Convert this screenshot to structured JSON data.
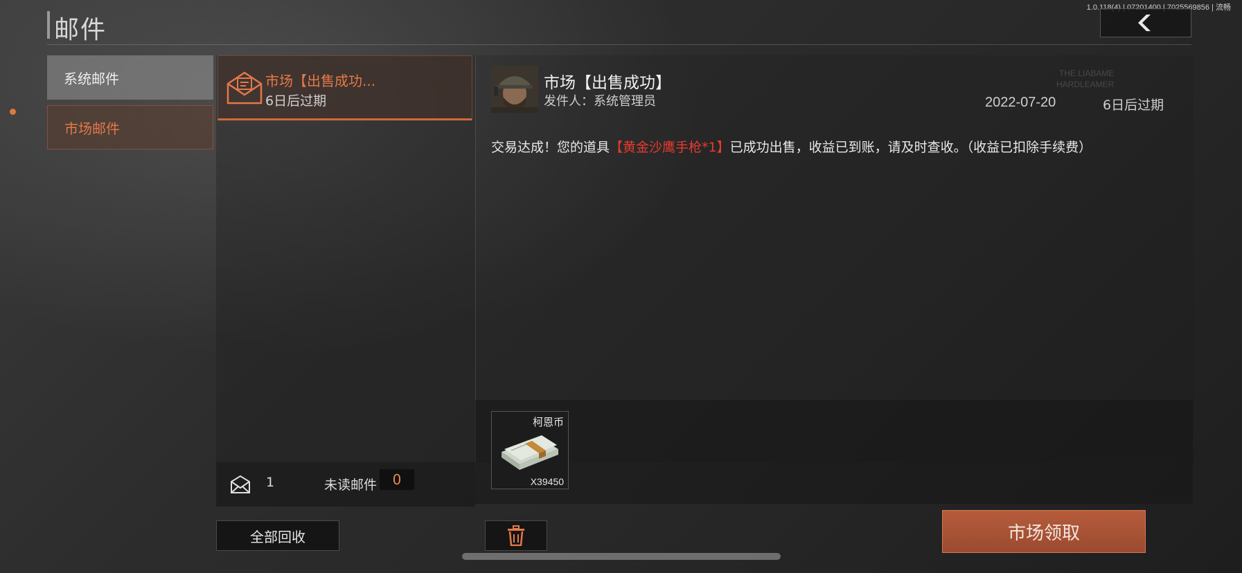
{
  "header": {
    "title": "邮件",
    "version": "1.0.118(4) | 07201400 | 7025569856 | 流畅"
  },
  "categories": [
    {
      "label": "系统邮件",
      "selected": false
    },
    {
      "label": "市场邮件",
      "selected": true
    }
  ],
  "mail_list": [
    {
      "title": "市场【出售成功...",
      "expiry": "6日后过期",
      "icon": "envelope-icon"
    }
  ],
  "stats": {
    "total_count": "1",
    "unread_label": "未读邮件",
    "unread_count": "0"
  },
  "actions": {
    "recycle_all": "全部回收",
    "claim": "市场领取"
  },
  "detail": {
    "title": "市场【出售成功】",
    "sender": "发件人：系统管理员",
    "date": "2022-07-20",
    "expiry": "6日后过期",
    "body_prefix": "交易达成！您的道具",
    "body_item": "【黄金沙鹰手枪*1】",
    "body_suffix": "已成功出售，收益已到账，请及时查收。（收益已扣除手续费）",
    "watermark_line1": "THE LIABAME",
    "watermark_line2": "HARDLEAMER"
  },
  "attachment": {
    "name": "柯恩币",
    "quantity": "X39450",
    "icon": "cash-stack-icon"
  },
  "colors": {
    "accent": "#e4784a",
    "highlight": "#e83a2e",
    "claim_button": "#b65c3c"
  }
}
